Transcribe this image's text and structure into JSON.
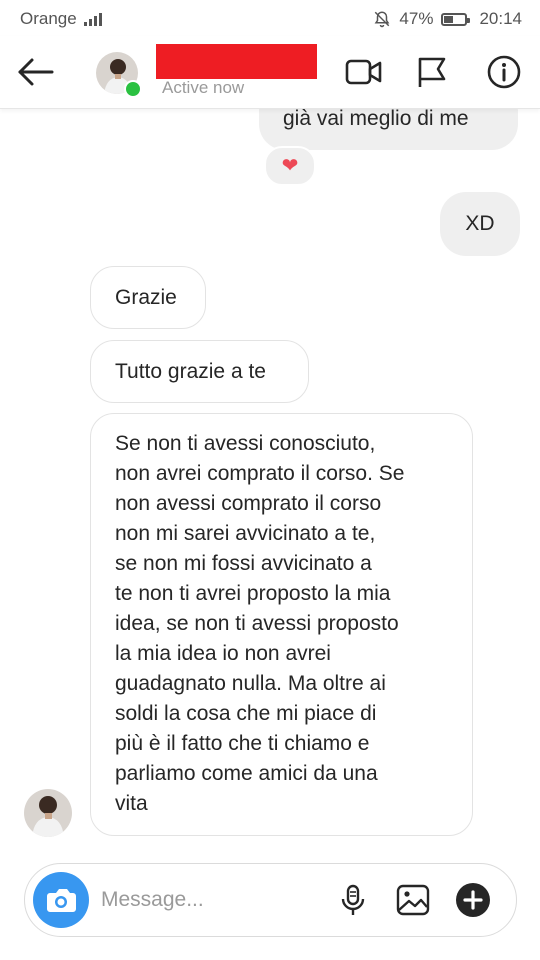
{
  "status_bar": {
    "carrier": "Orange",
    "battery": "47%",
    "time": "20:14",
    "battery_level": 0.47
  },
  "header": {
    "subtitle": "Active now"
  },
  "messages": [
    {
      "side": "sent",
      "text": "già vai meglio di me",
      "reaction": "❤"
    },
    {
      "side": "sent",
      "text": "XD"
    },
    {
      "side": "received",
      "text": "Grazie"
    },
    {
      "side": "received",
      "text": "Tutto grazie a te"
    },
    {
      "side": "received",
      "lines": [
        "Se non ti avessi conosciuto,",
        "non avrei comprato il corso. Se",
        "non avessi comprato il corso",
        "non mi sarei avvicinato a te,",
        "se non mi fossi avvicinato a",
        "te non ti avrei proposto la mia",
        "idea, se non ti avessi proposto",
        "la mia idea io non avrei",
        "guadagnato nulla. Ma oltre ai",
        "soldi la cosa che mi piace di",
        "più è il fatto che ti chiamo e",
        "parliamo come amici da una",
        "vita"
      ]
    }
  ],
  "composer": {
    "placeholder": "Message..."
  },
  "colors": {
    "online": "#2ac141",
    "camera": "#3897f0",
    "heart": "#ed4956",
    "redaction": "#ee1d23"
  }
}
